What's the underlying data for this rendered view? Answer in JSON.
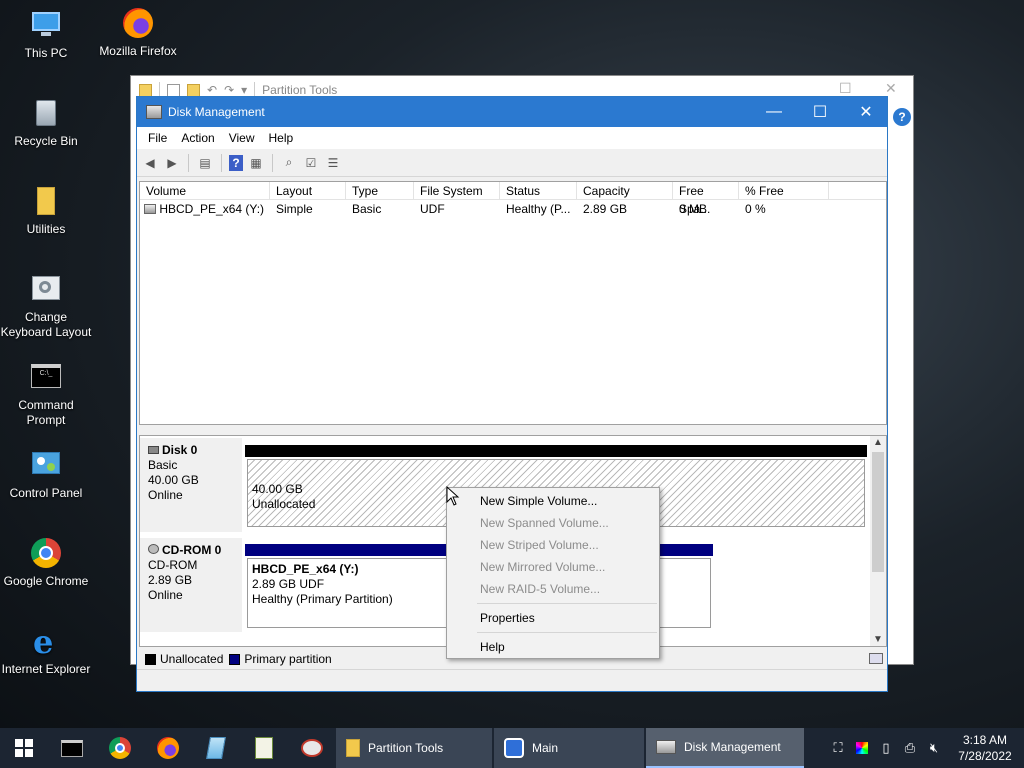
{
  "desktop": {
    "icons": [
      {
        "label": "This PC"
      },
      {
        "label": "Mozilla Firefox"
      },
      {
        "label": "Recycle Bin"
      },
      {
        "label": "Utilities"
      },
      {
        "label": "Change Keyboard Layout"
      },
      {
        "label": "Command Prompt"
      },
      {
        "label": "Control Panel"
      },
      {
        "label": "Google Chrome"
      },
      {
        "label": "Internet Explorer"
      }
    ]
  },
  "bg_window": {
    "title": "Partition Tools"
  },
  "window": {
    "title": "Disk Management",
    "menu": [
      "File",
      "Action",
      "View",
      "Help"
    ],
    "columns": [
      "Volume",
      "Layout",
      "Type",
      "File System",
      "Status",
      "Capacity",
      "Free Spa...",
      "% Free"
    ],
    "volumes": [
      {
        "volume": "HBCD_PE_x64 (Y:)",
        "layout": "Simple",
        "type": "Basic",
        "fs": "UDF",
        "status": "Healthy (P...",
        "capacity": "2.89 GB",
        "free": "0 MB",
        "pct": "0 %"
      }
    ],
    "disks": [
      {
        "name": "Disk 0",
        "type": "Basic",
        "size": "40.00 GB",
        "state": "Online",
        "partition": {
          "size": "40.00 GB",
          "label": "Unallocated"
        }
      },
      {
        "name": "CD-ROM 0",
        "type": "CD-ROM",
        "size": "2.89 GB",
        "state": "Online",
        "partition": {
          "name": "HBCD_PE_x64  (Y:)",
          "size": "2.89 GB UDF",
          "status": "Healthy (Primary Partition)"
        }
      }
    ],
    "legend": [
      "Unallocated",
      "Primary partition"
    ],
    "colors": {
      "unallocated": "#000000",
      "primary": "#000080",
      "titlebar": "#2b79d0"
    }
  },
  "context_menu": {
    "items": [
      {
        "label": "New Simple Volume...",
        "enabled": true
      },
      {
        "label": "New Spanned Volume...",
        "enabled": false
      },
      {
        "label": "New Striped Volume...",
        "enabled": false
      },
      {
        "label": "New Mirrored Volume...",
        "enabled": false
      },
      {
        "label": "New RAID-5 Volume...",
        "enabled": false
      },
      {
        "label": "Properties",
        "enabled": true
      },
      {
        "label": "Help",
        "enabled": true
      }
    ]
  },
  "taskbar": {
    "apps": [
      "Partition Tools",
      "Main",
      "Disk Management"
    ],
    "time": "3:18 AM",
    "date": "7/28/2022"
  }
}
